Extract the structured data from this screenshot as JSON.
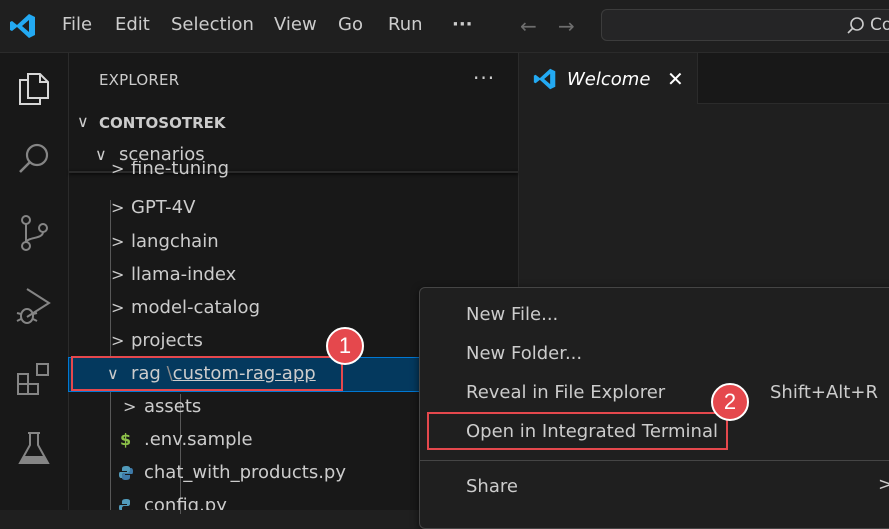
{
  "menu": {
    "file": "File",
    "edit": "Edit",
    "selection": "Selection",
    "view": "View",
    "go": "Go",
    "run": "Run",
    "more": "···",
    "back": "←",
    "forward": "→"
  },
  "search": {
    "text": "Co"
  },
  "explorer": {
    "title": "EXPLORER",
    "more": "···",
    "root": "CONTOSOTREK",
    "items": [
      {
        "label": "scenarios",
        "expanded": true
      },
      {
        "label": "fine-tuning",
        "expanded": false
      },
      {
        "label": "GPT-4V",
        "expanded": false
      },
      {
        "label": "langchain",
        "expanded": false
      },
      {
        "label": "llama-index",
        "expanded": false
      },
      {
        "label": "model-catalog",
        "expanded": false
      },
      {
        "label": "projects",
        "expanded": false
      },
      {
        "label_parent": "rag",
        "separator": "\\",
        "label_child": "custom-rag-app",
        "expanded": true
      },
      {
        "label": "assets",
        "expanded": false
      },
      {
        "label": ".env.sample",
        "icon": "dollar-icon"
      },
      {
        "label": "chat_with_products.py",
        "icon": "python-icon"
      },
      {
        "label": "config.py",
        "icon": "python-icon"
      }
    ]
  },
  "editor": {
    "tab_label": "Welcome",
    "tab_close": "✕"
  },
  "context_menu": {
    "items": [
      {
        "label": "New File..."
      },
      {
        "label": "New Folder..."
      },
      {
        "label": "Reveal in File Explorer",
        "shortcut": "Shift+Alt+R"
      },
      {
        "label": "Open in Integrated Terminal"
      },
      {
        "label": "Share"
      }
    ]
  },
  "annotations": {
    "badge1": "1",
    "badge2": "2"
  },
  "colors": {
    "accent": "#0078d4",
    "annotation_red": "#e5484d",
    "vscode_blue": "#23a9f2"
  }
}
